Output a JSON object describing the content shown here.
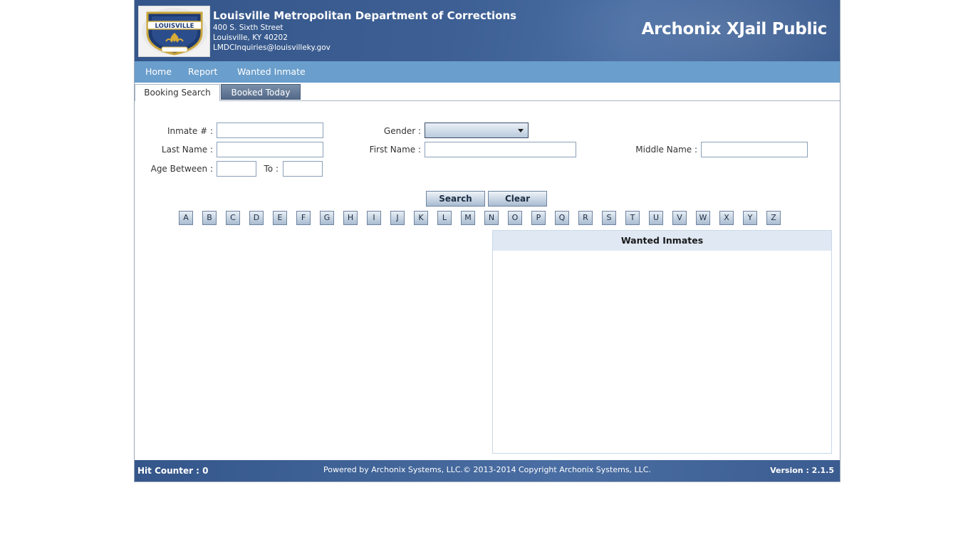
{
  "header": {
    "department_name": "Louisville Metropolitan Department of Corrections",
    "address_line1": "400 S. Sixth Street",
    "address_line2": "Louisville, KY 40202",
    "email": "LMDCInquiries@louisvilleky.gov",
    "app_title": "Archonix XJail Public",
    "logo_text": "LOUISVILLE"
  },
  "nav": {
    "home": "Home",
    "report": "Report",
    "wanted_inmate": "Wanted Inmate"
  },
  "tabs": {
    "booking_search": "Booking Search",
    "booked_today": "Booked Today"
  },
  "form": {
    "inmate_label": "Inmate # :",
    "inmate_value": "",
    "gender_label": "Gender :",
    "gender_value": "",
    "last_name_label": "Last Name :",
    "last_name_value": "",
    "first_name_label": "First Name :",
    "first_name_value": "",
    "middle_name_label": "Middle Name :",
    "middle_name_value": "",
    "age_between_label": "Age Between :",
    "age_from_value": "",
    "to_label": "To :",
    "age_to_value": "",
    "search_button": "Search",
    "clear_button": "Clear"
  },
  "letters": [
    "A",
    "B",
    "C",
    "D",
    "E",
    "F",
    "G",
    "H",
    "I",
    "J",
    "K",
    "L",
    "M",
    "N",
    "O",
    "P",
    "Q",
    "R",
    "S",
    "T",
    "U",
    "V",
    "W",
    "X",
    "Y",
    "Z"
  ],
  "wanted_panel": {
    "title": "Wanted Inmates"
  },
  "footer": {
    "hit_counter": "Hit Counter : 0",
    "powered_by": "Powered by Archonix Systems, LLC.© 2013-2014 Copyright Archonix Systems, LLC.",
    "version": "Version : 2.1.5"
  },
  "colors": {
    "header_blue": "#3d5f93",
    "nav_blue": "#6a9ecc",
    "panel_header": "#dfe8f3"
  }
}
